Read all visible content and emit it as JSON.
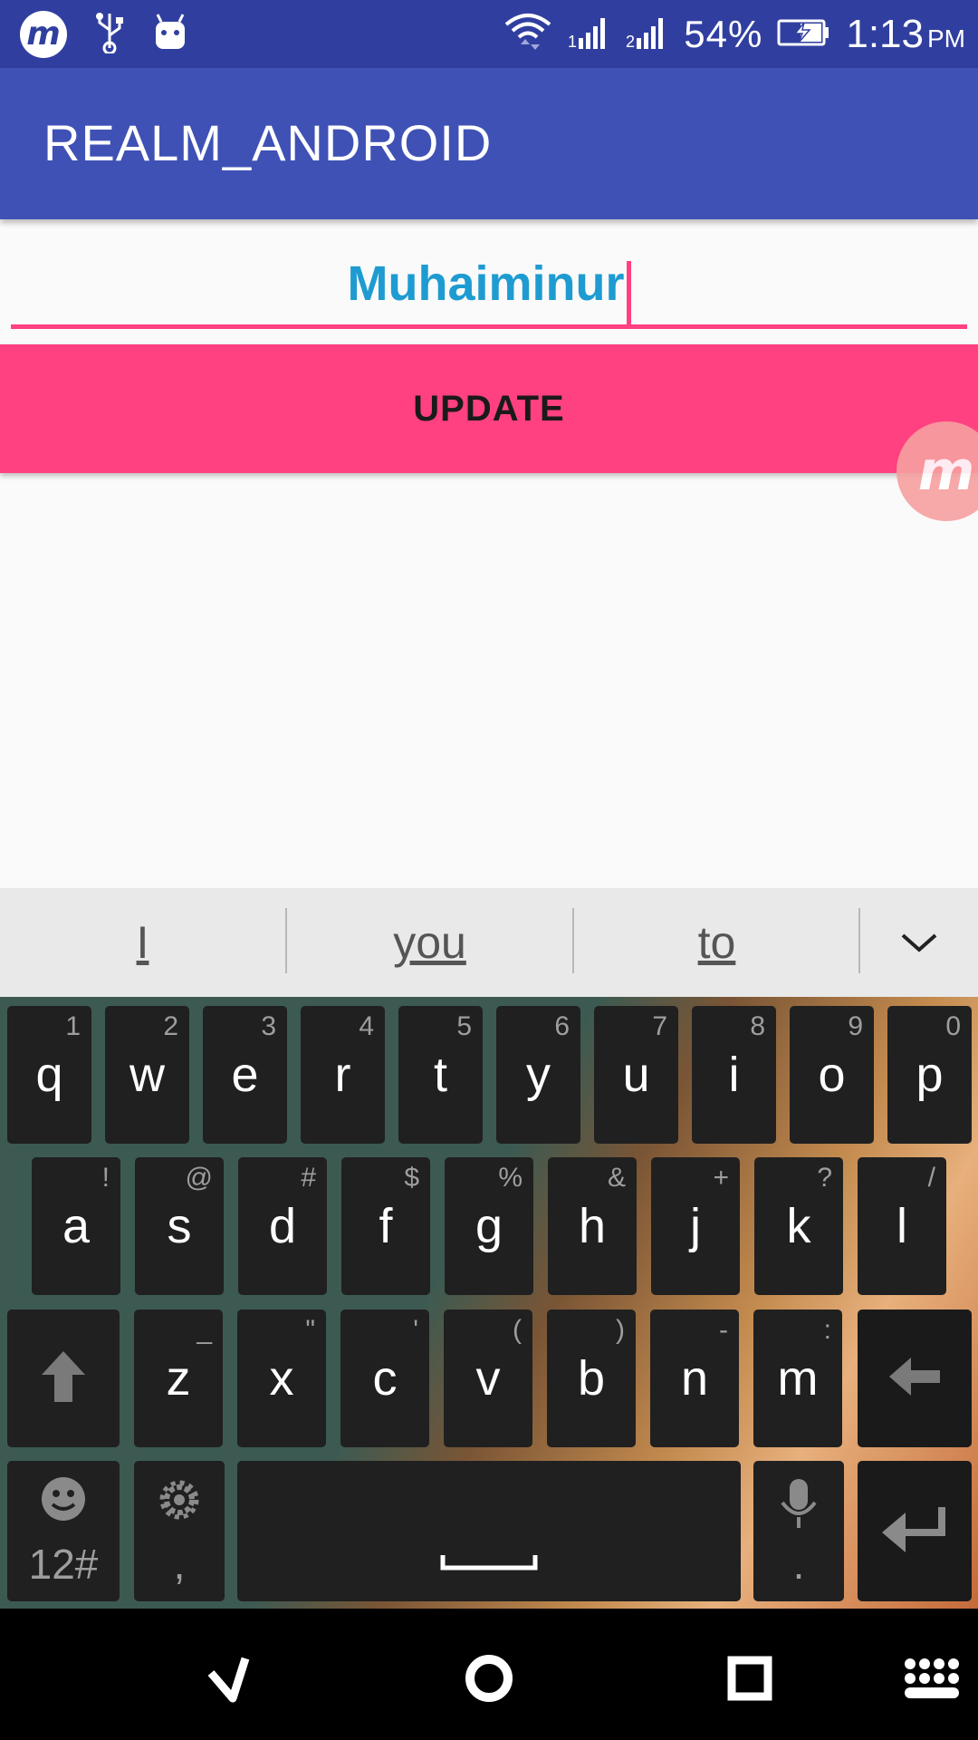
{
  "status_bar": {
    "battery": "54%",
    "time": "1:13",
    "ampm": "PM",
    "icons": [
      "mobizen-icon",
      "usb-icon",
      "android-icon",
      "wifi-icon",
      "signal-1-icon",
      "signal-2-icon",
      "battery-charging-icon"
    ]
  },
  "app_bar": {
    "title": "REALM_ANDROID"
  },
  "form": {
    "name_value": "Muhaiminur",
    "update_label": "UPDATE"
  },
  "keyboard": {
    "suggestions": [
      "I",
      "you",
      "to"
    ],
    "row1": [
      {
        "k": "q",
        "h": "1"
      },
      {
        "k": "w",
        "h": "2"
      },
      {
        "k": "e",
        "h": "3"
      },
      {
        "k": "r",
        "h": "4"
      },
      {
        "k": "t",
        "h": "5"
      },
      {
        "k": "y",
        "h": "6"
      },
      {
        "k": "u",
        "h": "7"
      },
      {
        "k": "i",
        "h": "8"
      },
      {
        "k": "o",
        "h": "9"
      },
      {
        "k": "p",
        "h": "0"
      }
    ],
    "row2": [
      {
        "k": "a",
        "h": "!"
      },
      {
        "k": "s",
        "h": "@"
      },
      {
        "k": "d",
        "h": "#"
      },
      {
        "k": "f",
        "h": "$"
      },
      {
        "k": "g",
        "h": "%"
      },
      {
        "k": "h",
        "h": "&"
      },
      {
        "k": "j",
        "h": "+"
      },
      {
        "k": "k",
        "h": "?"
      },
      {
        "k": "l",
        "h": "/"
      }
    ],
    "row3": [
      {
        "k": "z",
        "h": "_"
      },
      {
        "k": "x",
        "h": "\""
      },
      {
        "k": "c",
        "h": "'"
      },
      {
        "k": "v",
        "h": "("
      },
      {
        "k": "b",
        "h": ")"
      },
      {
        "k": "n",
        "h": "-"
      },
      {
        "k": "m",
        "h": ":"
      }
    ],
    "symbols_label": "12#",
    "comma_label": ",",
    "period_label": "."
  },
  "colors": {
    "status_bar": "#303f9f",
    "app_bar": "#3f51b5",
    "accent": "#ff4081",
    "input_text": "#1e9bd1"
  }
}
